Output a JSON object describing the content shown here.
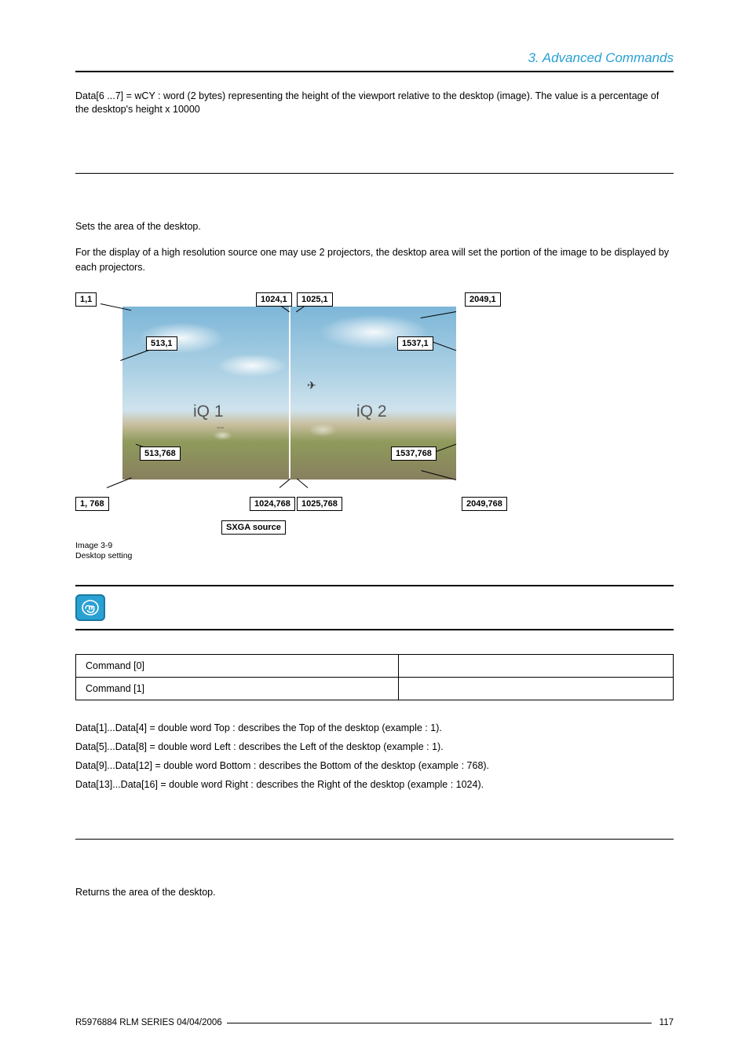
{
  "header": {
    "chapter": "3.  Advanced Commands"
  },
  "intro_text": "Data[6 ...7] = wCY : word (2 bytes) representing the height of the viewport relative to the desktop (image). The value is a percentage of the desktop's height x 10000",
  "section1": {
    "line1": "Sets the area of the desktop.",
    "line2": "For the display of a high resolution source one may use 2 projectors, the desktop area will set the portion of the image to be displayed by each projectors."
  },
  "figure": {
    "coords": {
      "tl": "1,1",
      "tm_l": "1024,1",
      "tm_r": "1025,1",
      "tr": "2049,1",
      "ml_l": "513,1",
      "mr_r": "1537,1",
      "ml_lb": "513,768",
      "mr_rb": "1537,768",
      "bl": "1, 768",
      "bm_l": "1024,768",
      "bm_r": "1025,768",
      "br": "2049,768",
      "src": "SXGA source"
    },
    "iq1": "iQ 1",
    "iq2": "iQ 2",
    "caption_a": "Image 3-9",
    "caption_b": "Desktop setting"
  },
  "cmd_table": {
    "r0c0": "Command [0]",
    "r0c1": "",
    "r1c0": "Command [1]",
    "r1c1": ""
  },
  "datalines": {
    "d1": "Data[1]...Data[4] = double word Top : describes the Top of the desktop (example : 1).",
    "d2": "Data[5]...Data[8] = double word Left : describes the Left of the desktop (example : 1).",
    "d3": "Data[9]...Data[12] = double word Bottom : describes the Bottom of the desktop (example : 768).",
    "d4": "Data[13]...Data[16] = double word Right : describes the Right of the desktop (example : 1024)."
  },
  "section2": {
    "line1": "Returns the area of the desktop."
  },
  "footer": {
    "left": "R5976884  RLM SERIES  04/04/2006",
    "page": "117"
  }
}
